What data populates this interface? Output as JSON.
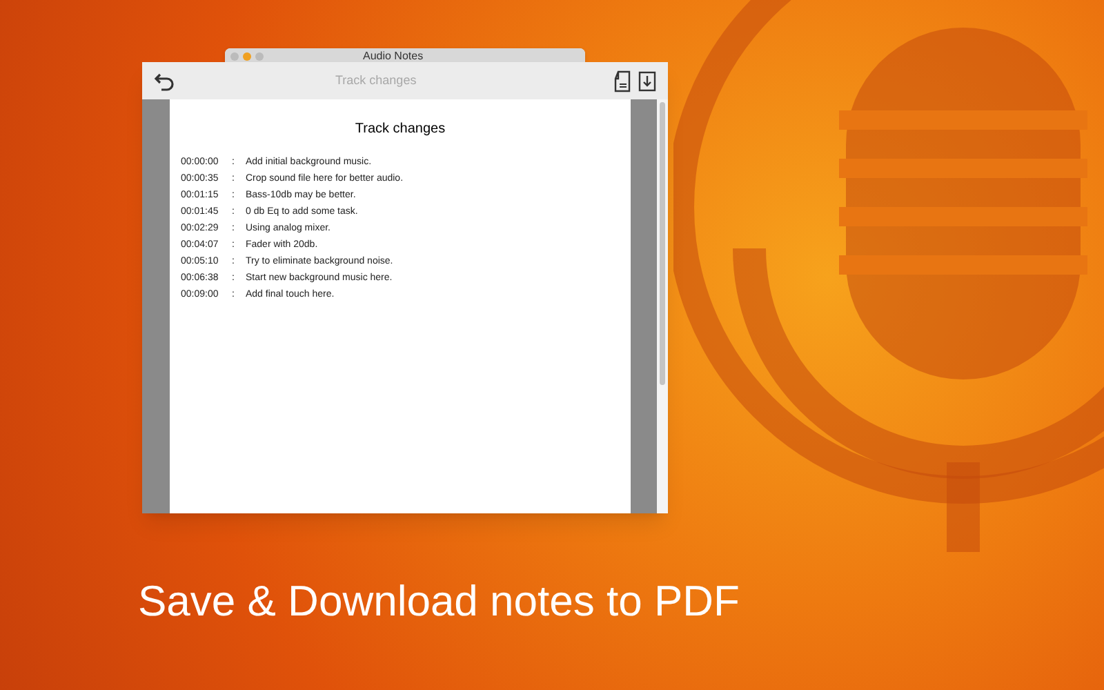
{
  "back_window": {
    "title": "Audio Notes",
    "heading": "Track changes"
  },
  "document": {
    "title": "Track changes",
    "separator": ":",
    "entries": [
      {
        "time": "00:00:00",
        "note": "Add initial background music."
      },
      {
        "time": "00:00:35",
        "note": "Crop sound file here for better audio."
      },
      {
        "time": "00:01:15",
        "note": "Bass-10db may be better."
      },
      {
        "time": "00:01:45",
        "note": "0 db Eq to add some task."
      },
      {
        "time": "00:02:29",
        "note": "Using analog mixer."
      },
      {
        "time": "00:04:07",
        "note": "Fader with 20db."
      },
      {
        "time": "00:05:10",
        "note": "Try to eliminate background noise."
      },
      {
        "time": "00:06:38",
        "note": "Start new background music here."
      },
      {
        "time": "00:09:00",
        "note": "Add final touch here."
      }
    ]
  },
  "caption": "Save & Download notes to PDF"
}
